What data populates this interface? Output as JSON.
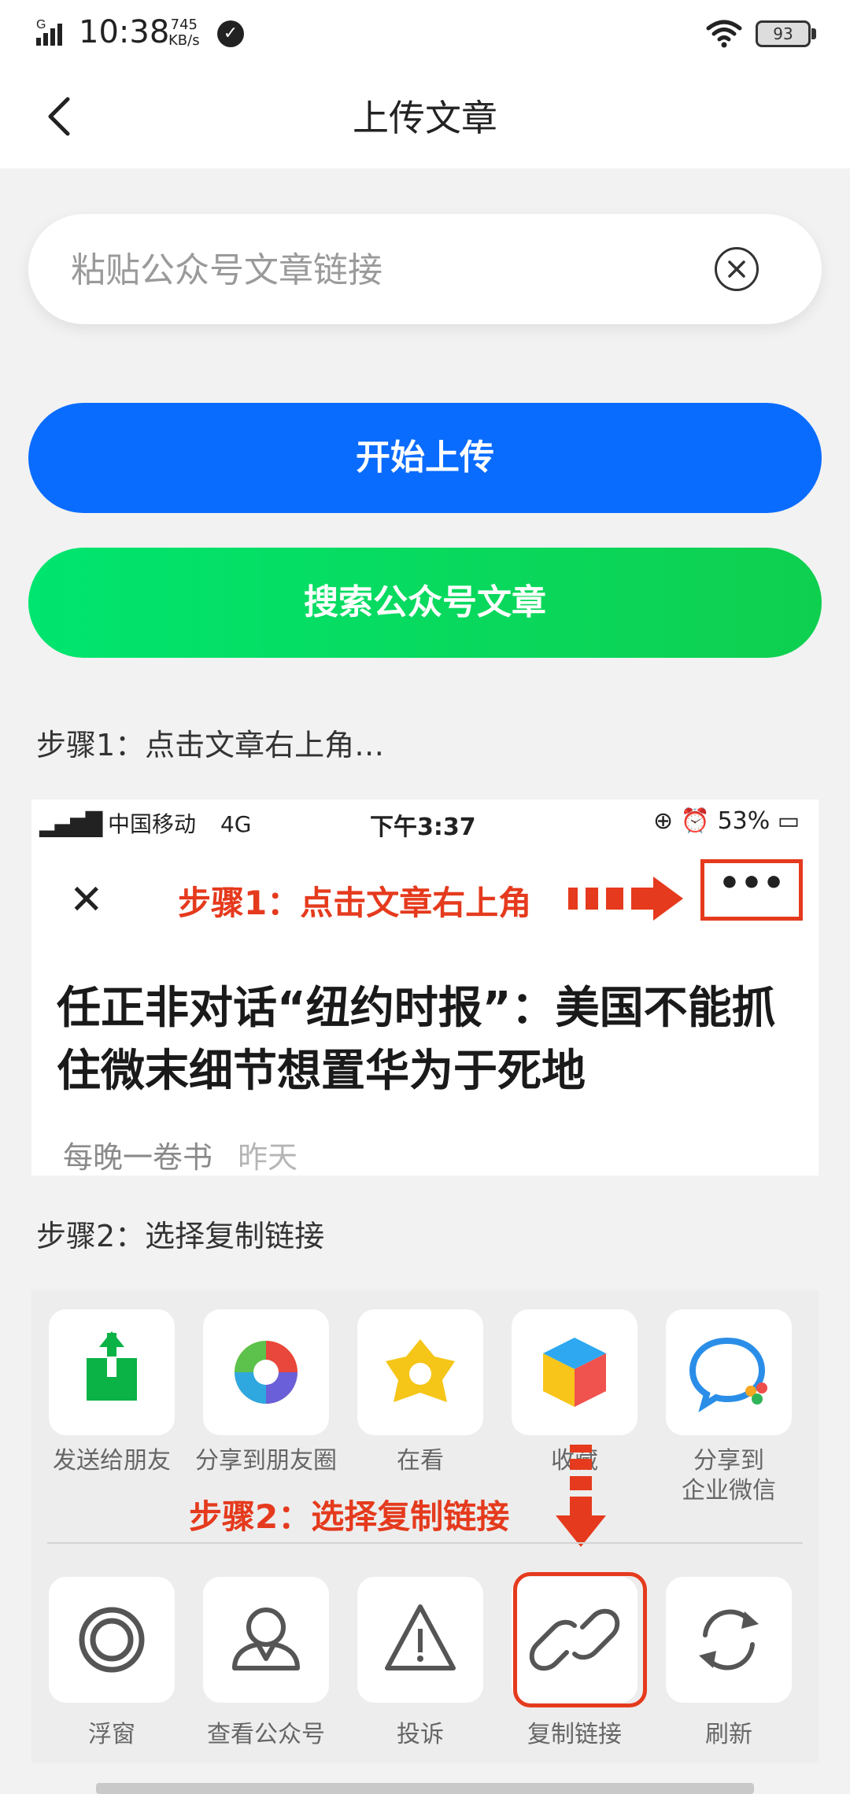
{
  "status_bar": {
    "network": "G",
    "time": "10:38",
    "speed_value": "745",
    "speed_unit": "KB/s",
    "battery": "93"
  },
  "header": {
    "title": "上传文章"
  },
  "link_input": {
    "placeholder": "粘贴公众号文章链接",
    "value": ""
  },
  "buttons": {
    "upload": "开始上传",
    "search": "搜索公众号文章"
  },
  "colors": {
    "upload_button": "#0a6cff",
    "search_button": "#00e56f",
    "annotation": "#e53a1d"
  },
  "step1": {
    "label": "步骤1：点击文章右上角…",
    "screenshot": {
      "carrier": "中国移动",
      "network": "4G",
      "time": "下午3:37",
      "battery": "53%",
      "annotation": "步骤1：点击文章右上角",
      "more_button": "•••",
      "headline": "任正非对话“纽约时报”：美国不能抓住微末细节想置华为于死地",
      "source": "每晚一卷书",
      "date": "昨天"
    }
  },
  "step2": {
    "label": "步骤2：选择复制链接",
    "screenshot": {
      "annotation": "步骤2：选择复制链接",
      "row1": [
        {
          "label": "发送给朋友",
          "icon": "send-to-friend-icon"
        },
        {
          "label": "分享到朋友圈",
          "icon": "moments-icon"
        },
        {
          "label": "在看",
          "icon": "wow-icon"
        },
        {
          "label": "收藏",
          "icon": "favorite-cube-icon"
        },
        {
          "label": "分享到\n企业微信",
          "icon": "wecom-icon"
        }
      ],
      "row2": [
        {
          "label": "浮窗",
          "icon": "floating-window-icon"
        },
        {
          "label": "查看公众号",
          "icon": "official-account-icon"
        },
        {
          "label": "投诉",
          "icon": "warning-icon"
        },
        {
          "label": "复制链接",
          "icon": "link-icon"
        },
        {
          "label": "刷新",
          "icon": "refresh-icon"
        }
      ]
    }
  }
}
